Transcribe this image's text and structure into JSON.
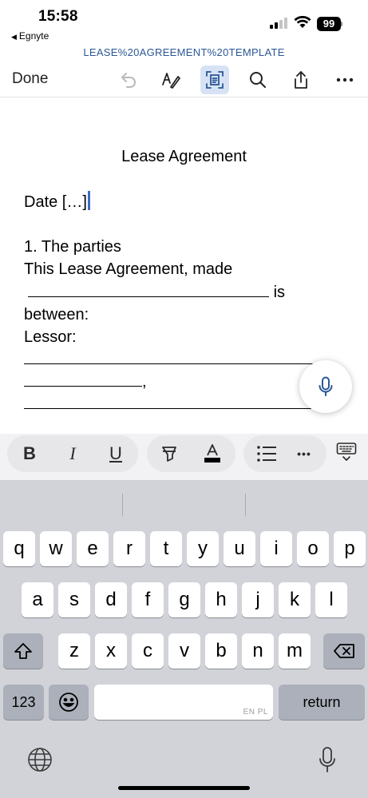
{
  "status_bar": {
    "time": "15:58",
    "back_app": "Egnyte",
    "battery": "99"
  },
  "header": {
    "doc_title": "LEASE%20AGREEMENT%20TEMPLATE",
    "done_label": "Done",
    "icons": [
      "undo-icon",
      "pen-icon",
      "reading-view-icon",
      "search-icon",
      "share-icon",
      "more-icon"
    ]
  },
  "document": {
    "heading": "Lease Agreement",
    "date_line": "Date […]",
    "section_title": "1. The parties",
    "line1": "This Lease Agreement, made",
    "line2_suffix": "is",
    "line3": "between:",
    "line4": "Lessor:",
    "line6_suffix": ","
  },
  "format_bar": {
    "bold": "B",
    "italic": "I",
    "underline": "U",
    "more": "•••"
  },
  "keyboard": {
    "row1": [
      "q",
      "w",
      "e",
      "r",
      "t",
      "y",
      "u",
      "i",
      "o",
      "p"
    ],
    "row2": [
      "a",
      "s",
      "d",
      "f",
      "g",
      "h",
      "j",
      "k",
      "l"
    ],
    "row3": [
      "z",
      "x",
      "c",
      "v",
      "b",
      "n",
      "m"
    ],
    "numbers_label": "123",
    "return_label": "return",
    "space_hint": "EN PL"
  },
  "colors": {
    "accent": "#2b5797",
    "cursor": "#3a6bc9",
    "keyboard_bg": "#d1d3d9"
  }
}
